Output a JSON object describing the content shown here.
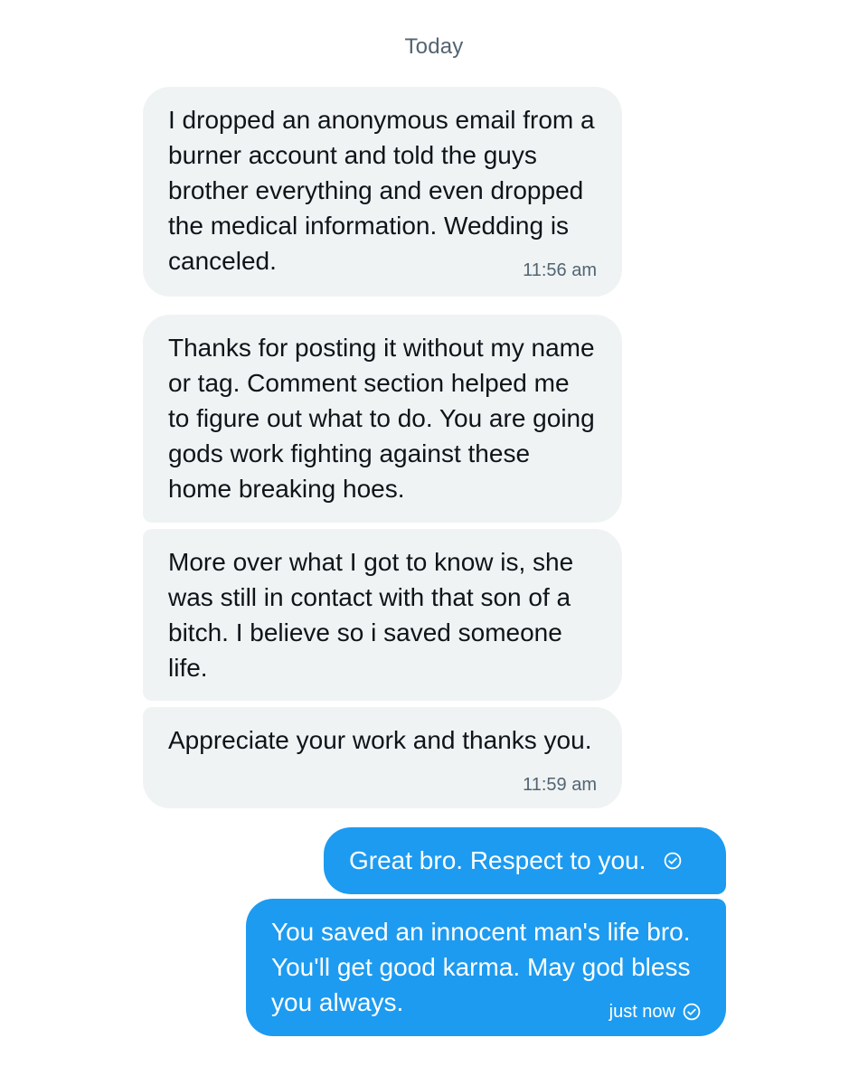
{
  "date_separator": "Today",
  "messages": [
    {
      "direction": "incoming",
      "text": "I dropped an anonymous email from a burner account and told the guys brother everything and even dropped the medical information. Wedding is canceled.",
      "time": "11:56 am"
    },
    {
      "direction": "incoming",
      "text": "Thanks for posting it without my name or tag. Comment section helped me to figure out what to do. You are going gods work fighting against these home breaking hoes.",
      "time": ""
    },
    {
      "direction": "incoming",
      "text": "More over what I got to know is, she was still in contact with that son of a bitch. I believe so i saved someone life.",
      "time": ""
    },
    {
      "direction": "incoming",
      "text": "Appreciate your work and thanks you.",
      "time": "11:59 am"
    },
    {
      "direction": "outgoing",
      "text": "Great bro. Respect to you.",
      "time": "",
      "status_icon": "sent-check-icon"
    },
    {
      "direction": "outgoing",
      "text": "You saved an innocent man's life bro. You'll get good karma. May god bless you always.",
      "time": "just now",
      "status_icon": "sent-check-icon"
    }
  ],
  "colors": {
    "incoming_bubble": "#eff3f4",
    "incoming_text": "#0f1419",
    "outgoing_bubble": "#1d9bf0",
    "outgoing_text": "#ffffff",
    "meta_gray": "#536471"
  }
}
